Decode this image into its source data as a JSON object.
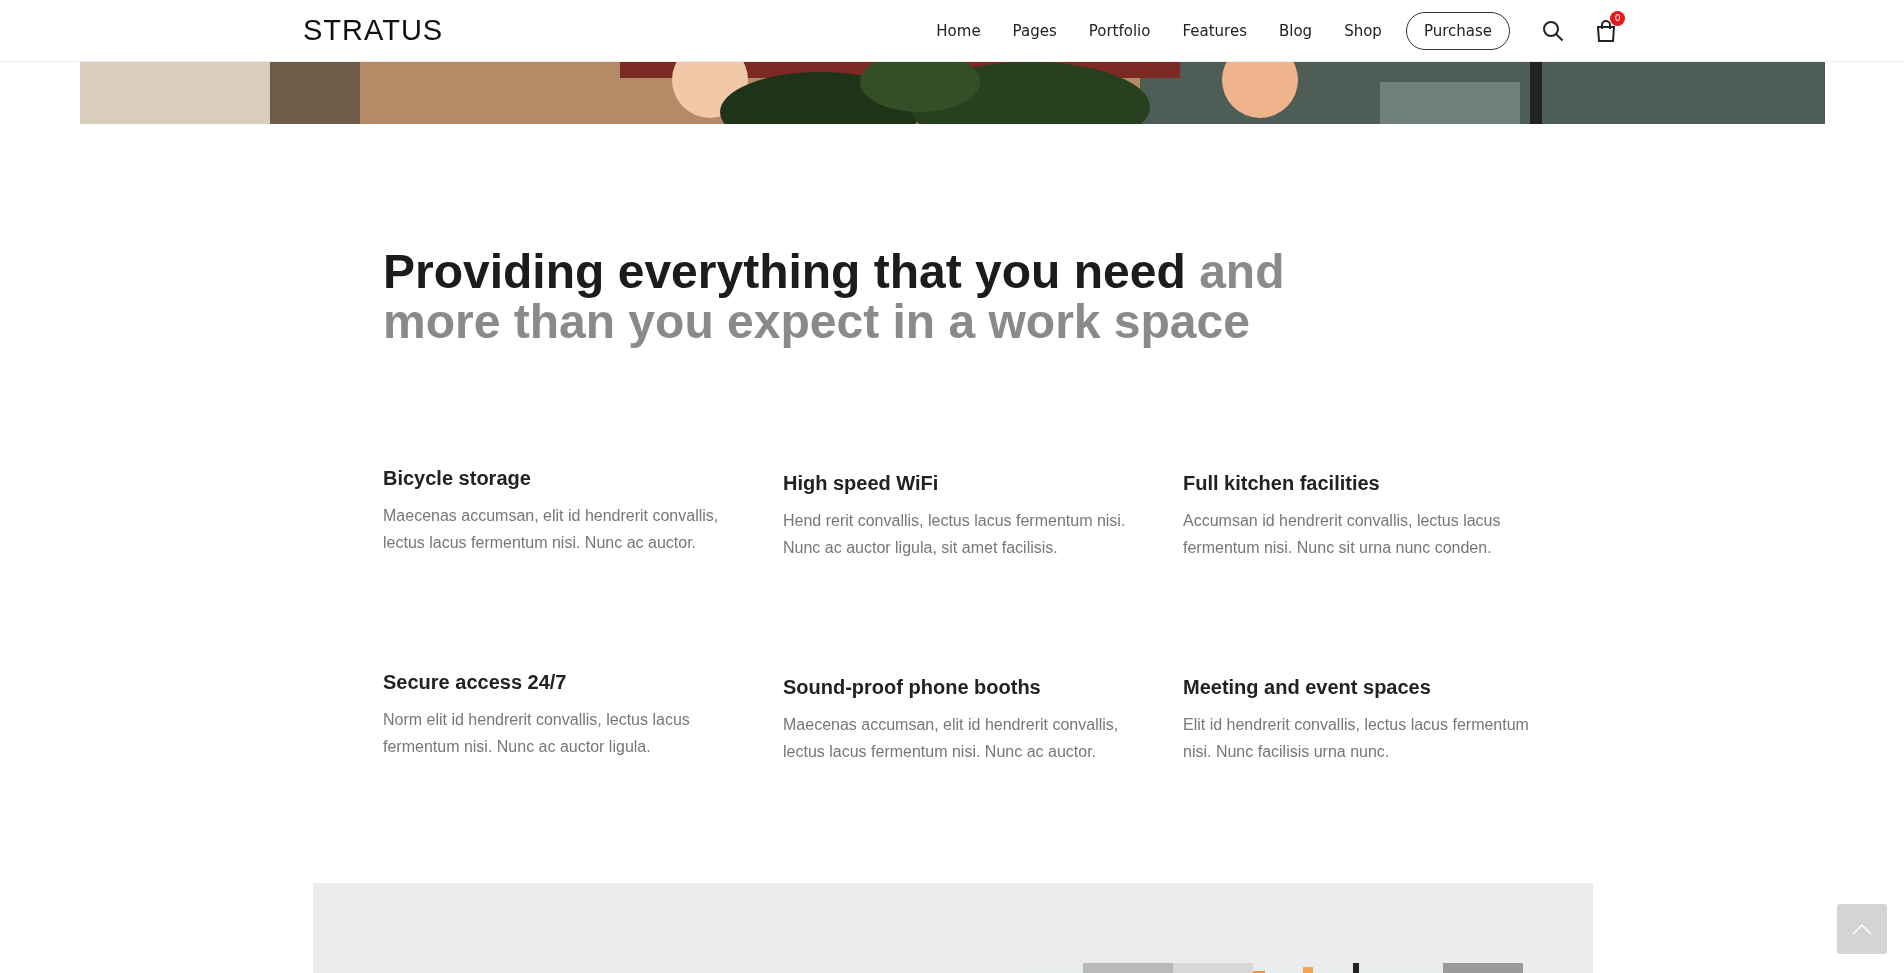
{
  "header": {
    "logo": "STRATUS",
    "nav": [
      "Home",
      "Pages",
      "Portfolio",
      "Features",
      "Blog",
      "Shop"
    ],
    "cta": "Purchase",
    "cart_count": "0"
  },
  "intro": {
    "heading_strong": "Providing everything that you need",
    "heading_muted": "and more than you expect in a work space"
  },
  "features": [
    {
      "title": "Bicycle storage",
      "text": "Maecenas accumsan, elit id hendrerit convallis, lectus lacus fermentum nisi. Nunc ac auctor."
    },
    {
      "title": "High speed WiFi",
      "text": "Hend rerit convallis, lectus lacus fermentum nisi. Nunc ac auctor ligula, sit amet facilisis."
    },
    {
      "title": "Full kitchen facilities",
      "text": "Accumsan id hendrerit convallis, lectus lacus fermentum nisi. Nunc sit urna nunc conden."
    },
    {
      "title": "Secure access 24/7",
      "text": "Norm elit id hendrerit convallis, lectus lacus fermentum nisi. Nunc ac auctor ligula."
    },
    {
      "title": "Sound-proof phone booths",
      "text": "Maecenas accumsan, elit id hendrerit convallis, lectus lacus fermentum nisi. Nunc ac auctor."
    },
    {
      "title": "Meeting and event spaces",
      "text": "Elit id hendrerit convallis, lectus lacus fermentum nisi. Nunc facilisis urna nunc."
    }
  ]
}
